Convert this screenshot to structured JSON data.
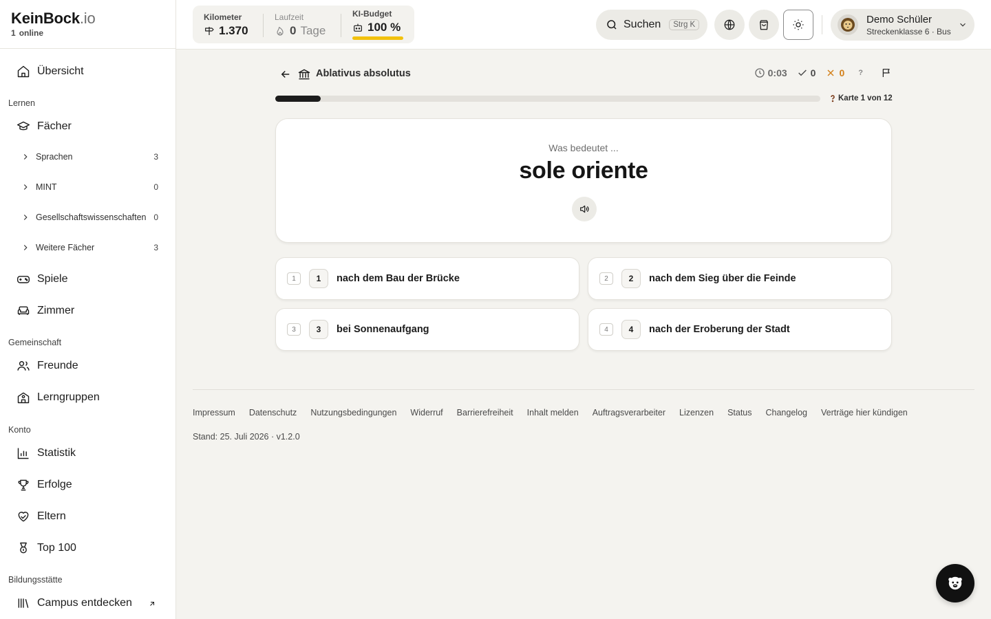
{
  "brand": {
    "name": "KeinBock",
    "tld": ".io",
    "online_count": "1",
    "online_label": "online"
  },
  "sidebar": {
    "overview": "Übersicht",
    "sections": {
      "learn": "Lernen",
      "community": "Gemeinschaft",
      "account": "Konto",
      "education": "Bildungsstätte"
    },
    "subjects": "Fächer",
    "subject_groups": [
      {
        "label": "Sprachen",
        "count": "3"
      },
      {
        "label": "MINT",
        "count": "0"
      },
      {
        "label": "Gesellschaftswissenschaften",
        "count": "0"
      },
      {
        "label": "Weitere Fächer",
        "count": "3"
      }
    ],
    "games": "Spiele",
    "room": "Zimmer",
    "friends": "Freunde",
    "study_groups": "Lerngruppen",
    "statistics": "Statistik",
    "achievements": "Erfolge",
    "parents": "Eltern",
    "top100": "Top 100",
    "campus": "Campus entdecken"
  },
  "topbar": {
    "km_label": "Kilometer",
    "km_value": "1.370",
    "runtime_label": "Laufzeit",
    "runtime_value": "0",
    "runtime_unit": "Tage",
    "budget_label": "KI-Budget",
    "budget_value": "100 %",
    "budget_fraction": 1.0,
    "search_label": "Suchen",
    "search_shortcut": "Strg K",
    "user_name": "Demo Schüler",
    "user_sub": "Streckenklasse 6 · Bus"
  },
  "quiz": {
    "deck_title": "Ablativus absolutus",
    "timer": "0:03",
    "correct": "0",
    "wrong": "0",
    "help": "?",
    "progress_fraction": 0.083,
    "card_counter": "Karte 1 von 12",
    "prompt": "Was bedeutet ...",
    "word": "sole oriente",
    "answers": [
      {
        "key": "1",
        "num": "1",
        "text": "nach dem Bau der Brücke"
      },
      {
        "key": "2",
        "num": "2",
        "text": "nach dem Sieg über die Feinde"
      },
      {
        "key": "3",
        "num": "3",
        "text": "bei Sonnenaufgang"
      },
      {
        "key": "4",
        "num": "4",
        "text": "nach der Eroberung der Stadt"
      }
    ]
  },
  "footer": {
    "links": [
      "Impressum",
      "Datenschutz",
      "Nutzungsbedingungen",
      "Widerruf",
      "Barrierefreiheit",
      "Inhalt melden",
      "Auftragsverarbeiter",
      "Lizenzen",
      "Status",
      "Changelog",
      "Verträge hier kündigen"
    ],
    "stand": "Stand: 25. Juli 2026 · v1.2.0"
  },
  "colors": {
    "accent_budget": "#f2c10d",
    "wrong": "#d3801a",
    "fab": "#111111"
  }
}
